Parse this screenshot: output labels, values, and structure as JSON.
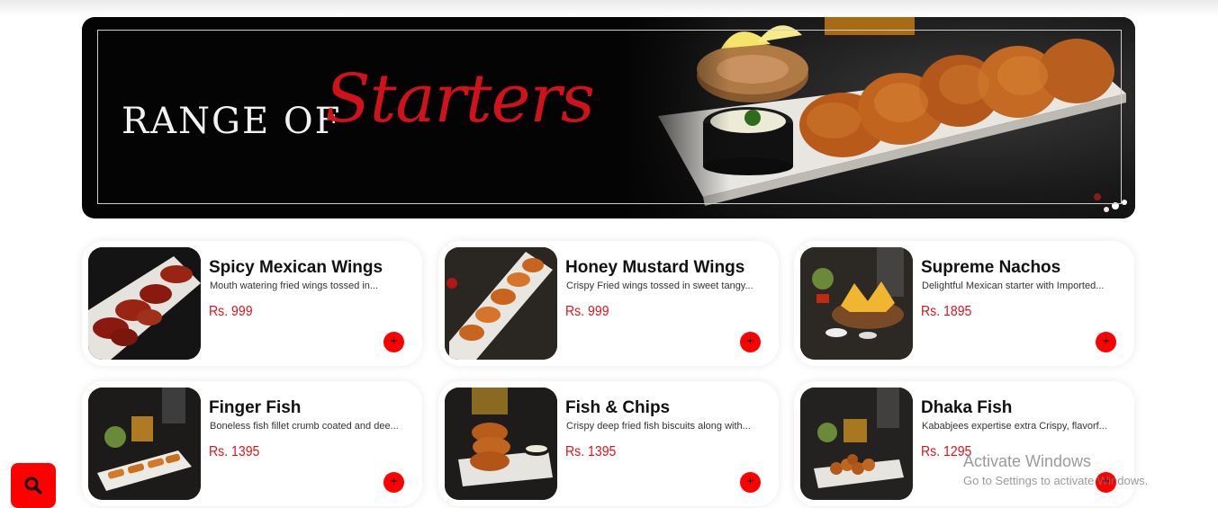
{
  "banner": {
    "title_prefix": "RANGE OF",
    "title_script": "Starters",
    "colors": {
      "script": "#d0121b",
      "background": "#040404"
    }
  },
  "menu": {
    "currency_color": "#e3101a",
    "add_button_color": "#ff0000",
    "add_icon": "plus-icon",
    "items": [
      {
        "name": "Spicy Mexican Wings",
        "description": "Mouth watering fried wings tossed in...",
        "price": "Rs. 999",
        "add_label": "+"
      },
      {
        "name": "Honey Mustard Wings",
        "description": "Crispy Fried wings tossed in sweet tangy...",
        "price": "Rs. 999",
        "add_label": "+"
      },
      {
        "name": "Supreme Nachos",
        "description": "Delightful Mexican starter with Imported...",
        "price": "Rs. 1895",
        "add_label": "+"
      },
      {
        "name": "Finger Fish",
        "description": "Boneless fish fillet crumb coated and dee...",
        "price": "Rs. 1395",
        "add_label": "+"
      },
      {
        "name": "Fish & Chips",
        "description": "Crispy deep fried fish biscuits along with...",
        "price": "Rs. 1395",
        "add_label": "+"
      },
      {
        "name": "Dhaka Fish",
        "description": "Kababjees expertise extra Crispy, flavorf...",
        "price": "Rs. 1295",
        "add_label": "+"
      }
    ]
  },
  "search_button": {
    "icon": "search-icon",
    "color": "#ff0000"
  },
  "watermark": {
    "line1": "Activate Windows",
    "line2": "Go to Settings to activate Windows."
  }
}
